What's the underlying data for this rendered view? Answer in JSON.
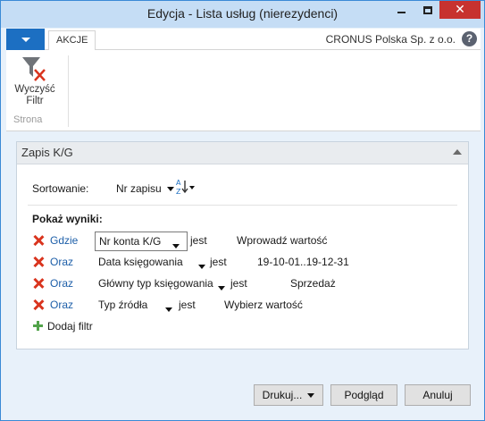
{
  "window": {
    "title": "Edycja - Lista usług (nierezydenci)"
  },
  "ribbon": {
    "tab": "AKCJE",
    "company": "CRONUS Polska Sp. z o.o.",
    "help": "?",
    "clear_filter_line1": "Wyczyść",
    "clear_filter_line2": "Filtr",
    "group": "Strona"
  },
  "panel": {
    "title": "Zapis K/G",
    "sort_label": "Sortowanie:",
    "sort_value": "Nr zapisu",
    "show_results": "Pokaż wyniki:",
    "filters": [
      {
        "conj": "Gdzie",
        "field": "Nr konta K/G",
        "op": "jest",
        "value": "Wprowadź wartość"
      },
      {
        "conj": "Oraz",
        "field": "Data księgowania",
        "op": "jest",
        "value": "19-10-01..19-12-31"
      },
      {
        "conj": "Oraz",
        "field": "Główny typ księgowania",
        "op": "jest",
        "value": "Sprzedaż"
      },
      {
        "conj": "Oraz",
        "field": "Typ źródła",
        "op": "jest",
        "value": "Wybierz wartość"
      }
    ],
    "add_filter": "Dodaj filtr"
  },
  "buttons": {
    "print": "Drukuj...",
    "preview": "Podgląd",
    "cancel": "Anuluj"
  },
  "colors": {
    "accent": "#1c6fc2",
    "remove": "#d9341e",
    "add": "#52a34a",
    "link": "#1c5ea8"
  }
}
